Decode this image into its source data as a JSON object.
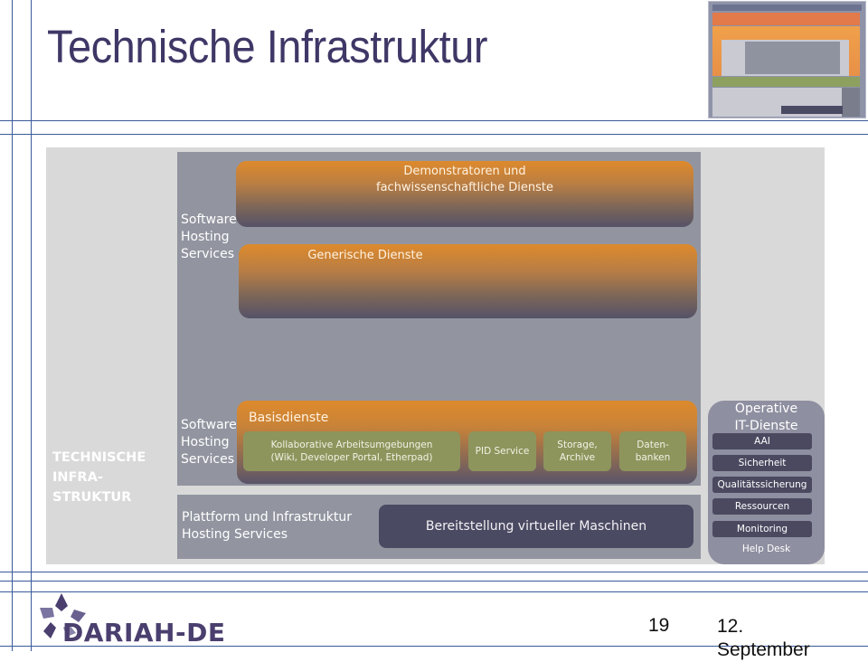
{
  "slide": {
    "title": "Technische Infrastruktur",
    "page_number": "19",
    "date_line1": "12.",
    "date_line2": "September"
  },
  "logo": {
    "text": "DARIAH-DE",
    "icon": "dariah-flower-icon"
  },
  "thumbnail": {
    "icon": "slide-overview-thumbnail"
  },
  "diagram": {
    "side_label": [
      "TECHNISCHE",
      "INFRA-",
      "STRUKTUR"
    ],
    "upper_layer": {
      "label": [
        "Software",
        "Hosting",
        "Services"
      ],
      "boxes": [
        {
          "text": [
            "Demonstratoren und",
            "fachwissenschaftliche Dienste"
          ]
        },
        {
          "text": [
            "Generische Dienste"
          ]
        }
      ]
    },
    "basis_layer": {
      "label": [
        "Software",
        "Hosting",
        "Services"
      ],
      "title": "Basisdienste",
      "items": [
        {
          "text": [
            "Kollaborative Arbeitsumgebungen",
            "(Wiki, Developer Portal, Etherpad)"
          ]
        },
        {
          "text": [
            "PID Service"
          ]
        },
        {
          "text": [
            "Storage,",
            "Archive"
          ]
        },
        {
          "text": [
            "Daten-",
            "banken"
          ]
        }
      ]
    },
    "platform_layer": {
      "label": [
        "Plattform und Infrastruktur",
        "Hosting Services"
      ],
      "vm_box": "Bereitstellung virtueller Maschinen"
    },
    "operations": {
      "title": [
        "Operative",
        "IT-Dienste"
      ],
      "items": [
        "AAI",
        "Sicherheit",
        "Qualitätssicherung",
        "Ressourcen",
        "Monitoring"
      ],
      "footer": "Help Desk"
    }
  },
  "colors": {
    "title": "#3f3766",
    "orange": "#de8a2c",
    "green": "#8d955d",
    "dark_slate": "#4b4a63",
    "gray_panel": "#9295a0",
    "light_panel": "#d9d9d9",
    "guide_lines": "#3a5a9a"
  }
}
